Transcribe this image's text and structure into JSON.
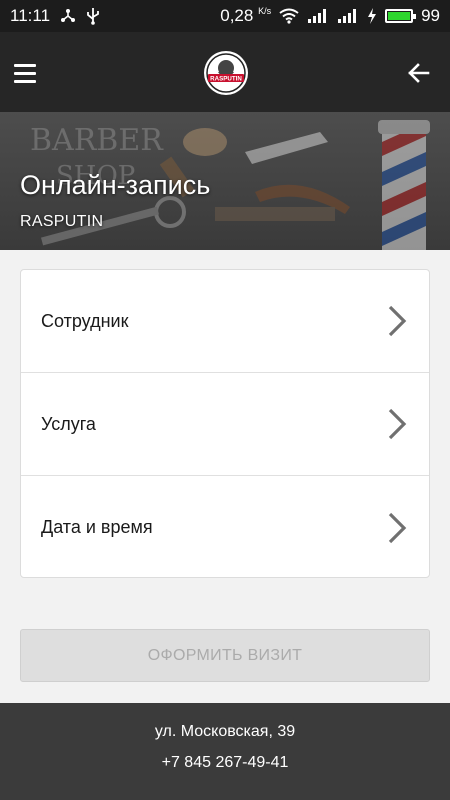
{
  "status_bar": {
    "time": "11:11",
    "speed": "0,28",
    "speed_unit": "K/s",
    "battery_level": "99",
    "battery_fraction": 0.99,
    "battery_color": "#2ed52e"
  },
  "toolbar": {
    "logo_text": "RASPUTIN",
    "menu_icon": "hamburger-menu-icon",
    "back_icon": "arrow-back-icon"
  },
  "hero": {
    "title": "Онлайн-запись",
    "subtitle": "RASPUTIN",
    "art_text_line1": "BARBER",
    "art_text_line2": "SHOP"
  },
  "booking": {
    "items": [
      {
        "label": "Сотрудник"
      },
      {
        "label": "Услуга"
      },
      {
        "label": "Дата и время"
      }
    ],
    "submit_label": "ОФОРМИТЬ ВИЗИТ"
  },
  "footer": {
    "address": "ул. Московская, 39",
    "phone": "+7 845 267-49-41"
  },
  "colors": {
    "toolbar_bg": "#262626",
    "footer_bg": "#3b3b3b",
    "button_disabled_bg": "#dedede",
    "button_disabled_text": "#ababab"
  }
}
